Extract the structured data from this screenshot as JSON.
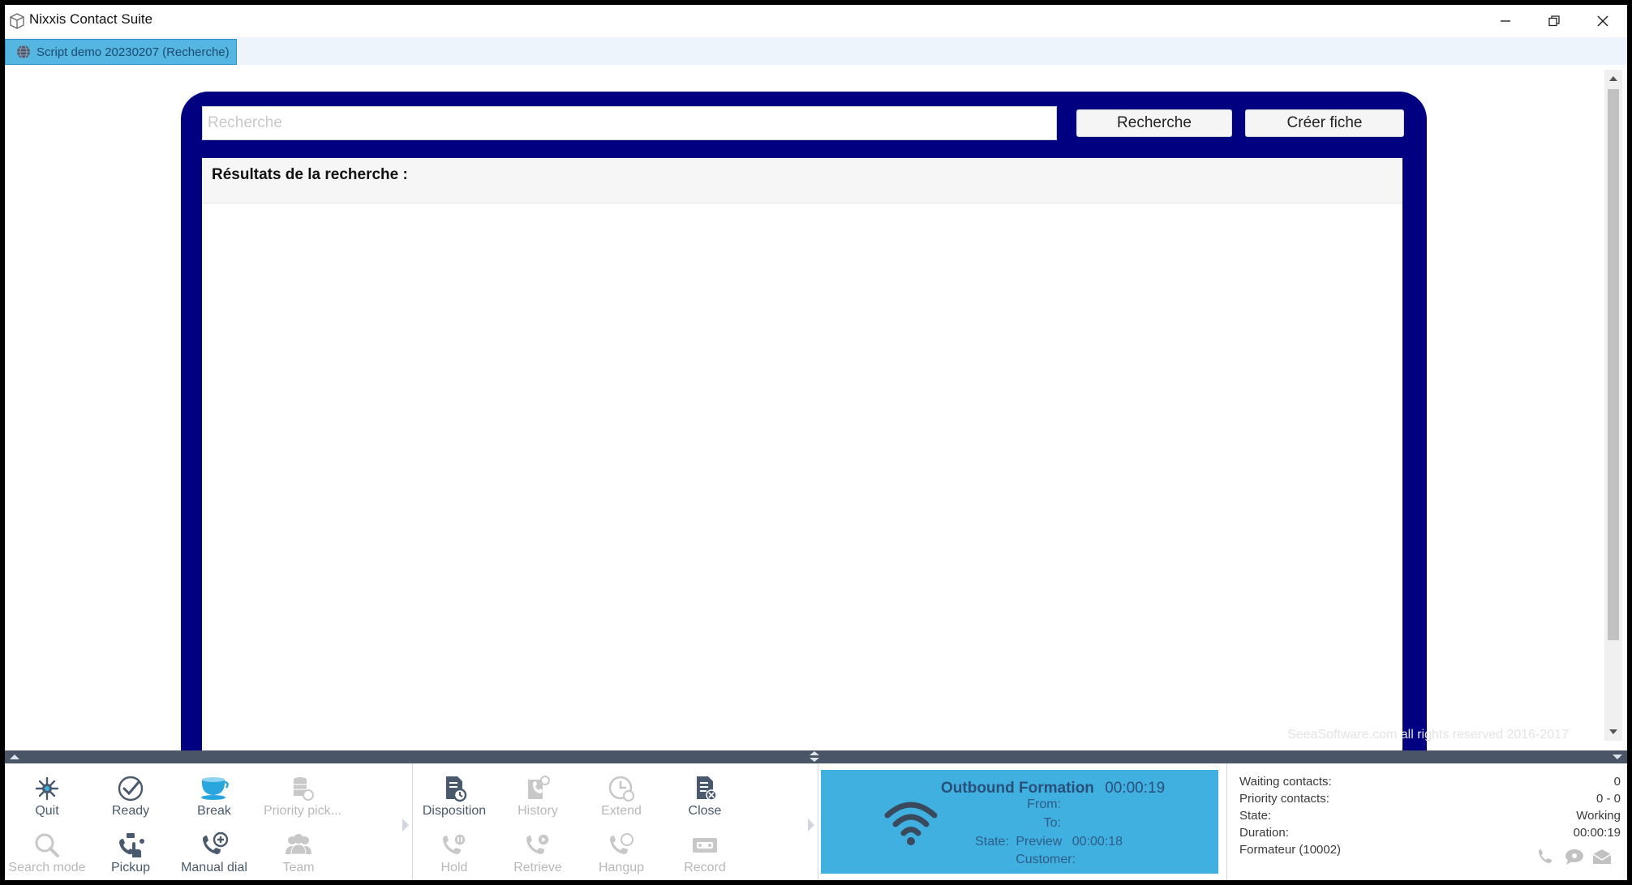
{
  "window": {
    "title": "Nixxis Contact Suite"
  },
  "tab": {
    "label": "Script demo 20230207 (Recherche)"
  },
  "search": {
    "placeholder": "Recherche",
    "value": "",
    "search_button": "Recherche",
    "create_button": "Créer fiche",
    "results_title": "Résultats de la recherche :"
  },
  "footer": {
    "copyright": "SeeaSoftware.com all rights reserved 2016-2017"
  },
  "toolbar": {
    "group1": [
      {
        "label": "Quit",
        "icon": "quit-icon",
        "disabled": false
      },
      {
        "label": "Ready",
        "icon": "ready-check-icon",
        "disabled": false
      },
      {
        "label": "Break",
        "icon": "coffee-cup-icon",
        "disabled": false
      },
      {
        "label": "Priority pick...",
        "icon": "priority-pick-icon",
        "disabled": true
      },
      {
        "label": "Search mode",
        "icon": "search-icon",
        "disabled": true
      },
      {
        "label": "Pickup",
        "icon": "pickup-icon",
        "disabled": false
      },
      {
        "label": "Manual dial",
        "icon": "manual-dial-icon",
        "disabled": false
      },
      {
        "label": "Team",
        "icon": "team-icon",
        "disabled": true
      }
    ],
    "group2": [
      {
        "label": "Disposition",
        "icon": "disposition-icon",
        "disabled": false
      },
      {
        "label": "History",
        "icon": "history-icon",
        "disabled": true
      },
      {
        "label": "Extend",
        "icon": "extend-clock-icon",
        "disabled": true
      },
      {
        "label": "Close",
        "icon": "close-document-icon",
        "disabled": false
      },
      {
        "label": "Hold",
        "icon": "hold-phone-icon",
        "disabled": true
      },
      {
        "label": "Retrieve",
        "icon": "retrieve-phone-icon",
        "disabled": true
      },
      {
        "label": "Hangup",
        "icon": "hangup-phone-icon",
        "disabled": true
      },
      {
        "label": "Record",
        "icon": "record-icon",
        "disabled": true
      }
    ]
  },
  "call": {
    "campaign": "Outbound Formation",
    "timer": "00:00:19",
    "from_label": "From:",
    "to_label": "To:",
    "state_label": "State:",
    "state_value": "Preview",
    "state_timer": "00:00:18",
    "customer_label": "Customer:",
    "icon": "wifi-signal-icon",
    "color": "#3fb0e0"
  },
  "stats": {
    "waiting_label": "Waiting contacts:",
    "waiting_value": "0",
    "priority_label": "Priority contacts:",
    "priority_value": "0 - 0",
    "state_label": "State:",
    "state_value": "Working",
    "duration_label": "Duration:",
    "duration_value": "00:00:19",
    "agent": "Formateur (10002)"
  },
  "colors": {
    "panel": "#000080",
    "tab": "#55b6e2",
    "splitter": "#4a5668"
  }
}
